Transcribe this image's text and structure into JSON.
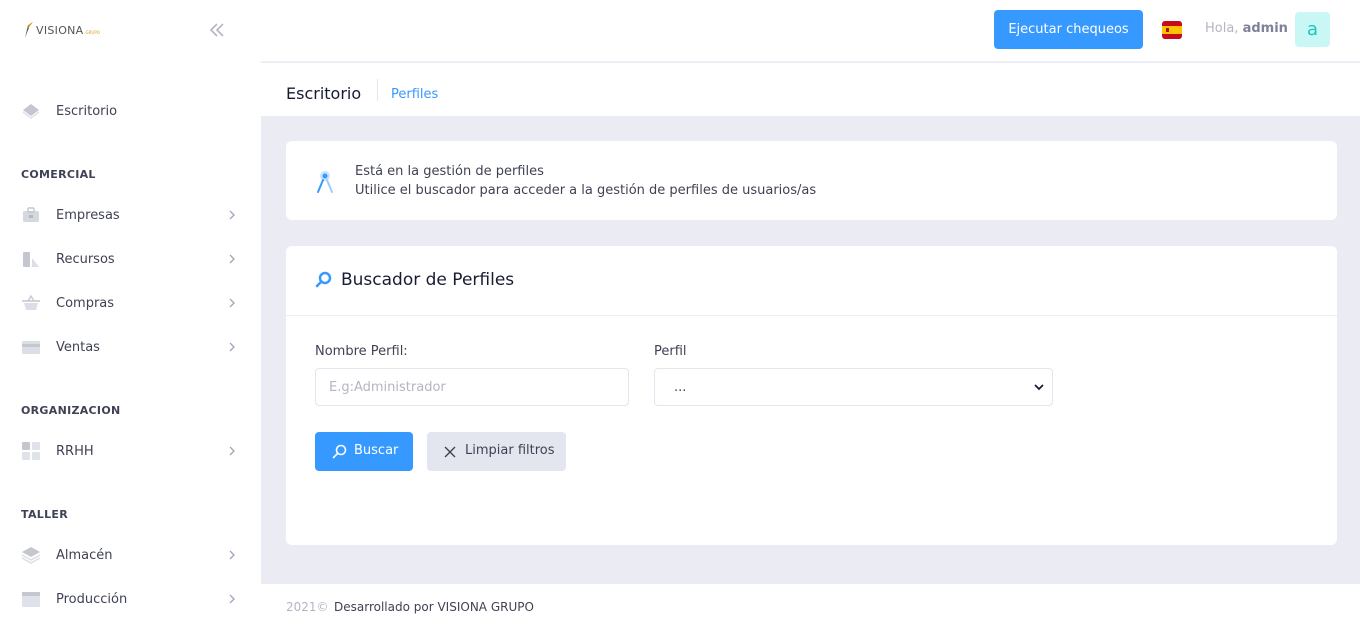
{
  "brand": {
    "name": "VISIONA",
    "sub": "GRUPO"
  },
  "sidebar": {
    "dashboard": "Escritorio",
    "sections": [
      {
        "title": "COMERCIAL",
        "items": [
          "Empresas",
          "Recursos",
          "Compras",
          "Ventas"
        ]
      },
      {
        "title": "ORGANIZACION",
        "items": [
          "RRHH"
        ]
      },
      {
        "title": "TALLER",
        "items": [
          "Almacén",
          "Producción"
        ]
      }
    ]
  },
  "header": {
    "action_button": "Ejecutar chequeos",
    "greeting": "Hola,",
    "user": "admin",
    "avatar_letter": "a",
    "language_flag": "es-flag-icon"
  },
  "subheader": {
    "title": "Escritorio",
    "link": "Perfiles"
  },
  "info": {
    "line1": "Está en la gestión de perfiles",
    "line2": "Utilice el buscador para acceder a la gestión de perfiles de usuarios/as"
  },
  "search": {
    "title": "Buscador de Perfiles",
    "name_label": "Nombre Perfil:",
    "name_placeholder": "E.g:Administrador",
    "profile_label": "Perfil",
    "profile_value": "...",
    "search_button": "Buscar",
    "clear_button": "Limpiar filtros"
  },
  "footer": {
    "year": "2021©",
    "text": "Desarrollado por VISIONA GRUPO"
  },
  "colors": {
    "primary": "#3699ff",
    "avatar_bg": "#c9f7f5",
    "avatar_fg": "#1bc5bd",
    "background": "#ebebf3"
  }
}
